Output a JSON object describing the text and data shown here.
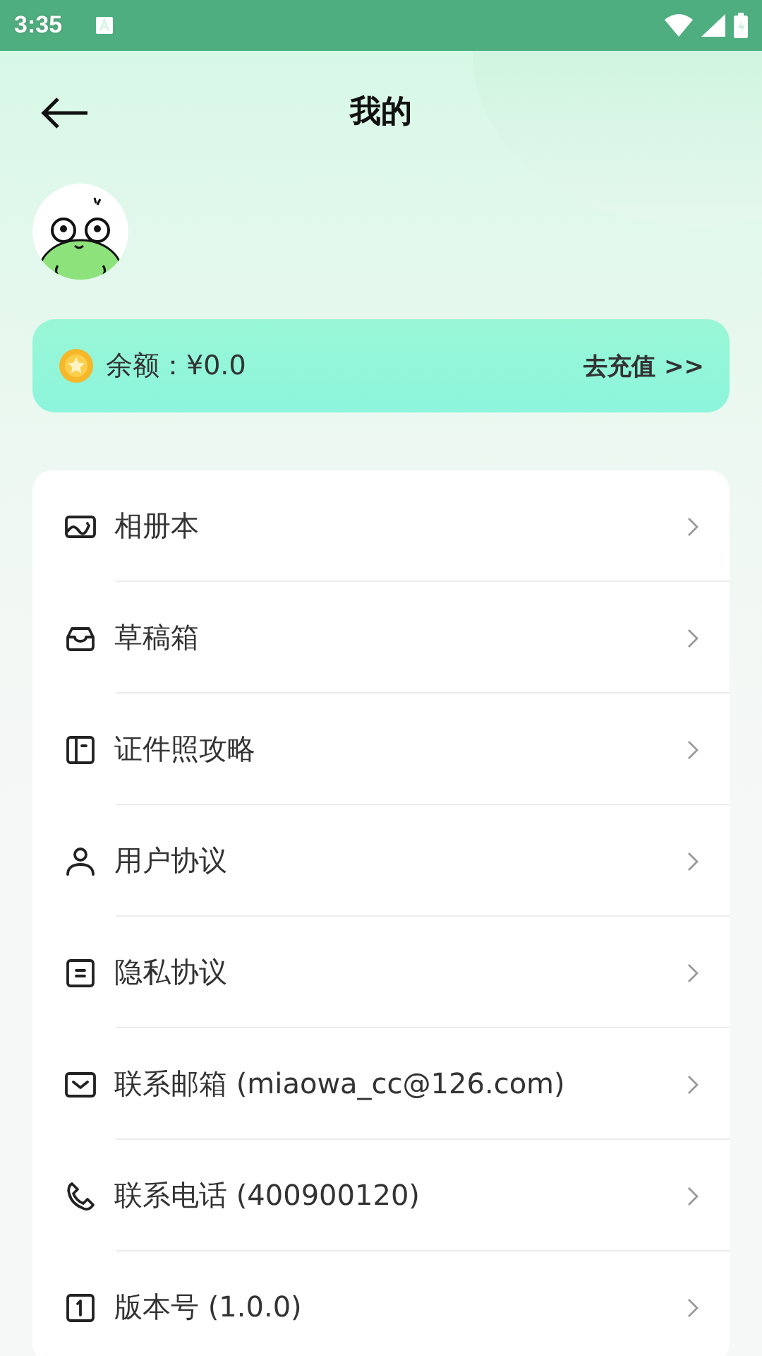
{
  "status_bar": {
    "time": "3:35"
  },
  "header": {
    "title": "我的"
  },
  "balance": {
    "label": "余额：¥0.0",
    "action": "去充值 >>"
  },
  "menu": [
    {
      "label": "相册本",
      "kind": "album"
    },
    {
      "label": "草稿箱",
      "kind": "drafts"
    },
    {
      "label": "证件照攻略",
      "kind": "guide"
    },
    {
      "label": "用户协议",
      "kind": "user"
    },
    {
      "label": "隐私协议",
      "kind": "privacy"
    },
    {
      "label": "联系邮箱 (miaowa_cc@126.com)",
      "kind": "email"
    },
    {
      "label": "联系电话 (400900120)",
      "kind": "phone"
    },
    {
      "label": "版本号 (1.0.0)",
      "kind": "version"
    }
  ]
}
